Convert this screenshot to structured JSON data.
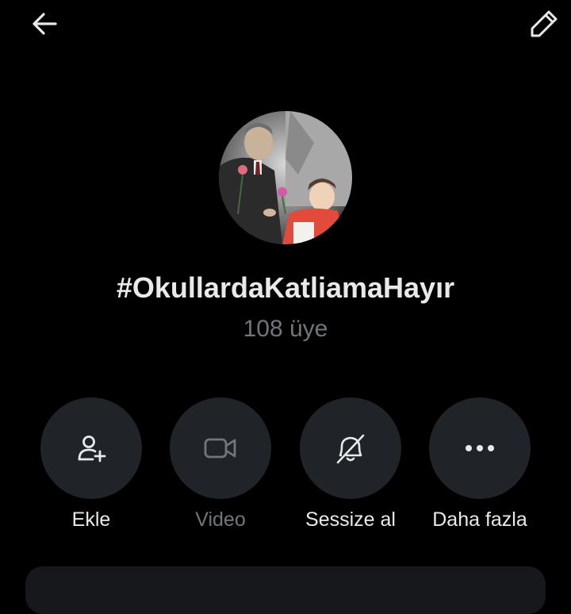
{
  "header": {
    "back_icon": "arrow-left-icon",
    "edit_icon": "pencil-icon"
  },
  "group": {
    "avatar": "group-avatar-photo",
    "title": "#OkullardaKatliamaHayır",
    "members": "108 üye"
  },
  "actions": [
    {
      "label": "Ekle",
      "icon": "add-user-icon",
      "enabled": true
    },
    {
      "label": "Video",
      "icon": "video-icon",
      "enabled": false
    },
    {
      "label": "Sessize al",
      "icon": "bell-off-icon",
      "enabled": true
    },
    {
      "label": "Daha fazla",
      "icon": "more-icon",
      "enabled": true
    }
  ],
  "colors": {
    "background": "#000000",
    "text": "#e7e9ea",
    "muted": "#71767b",
    "circle": "#202327"
  }
}
